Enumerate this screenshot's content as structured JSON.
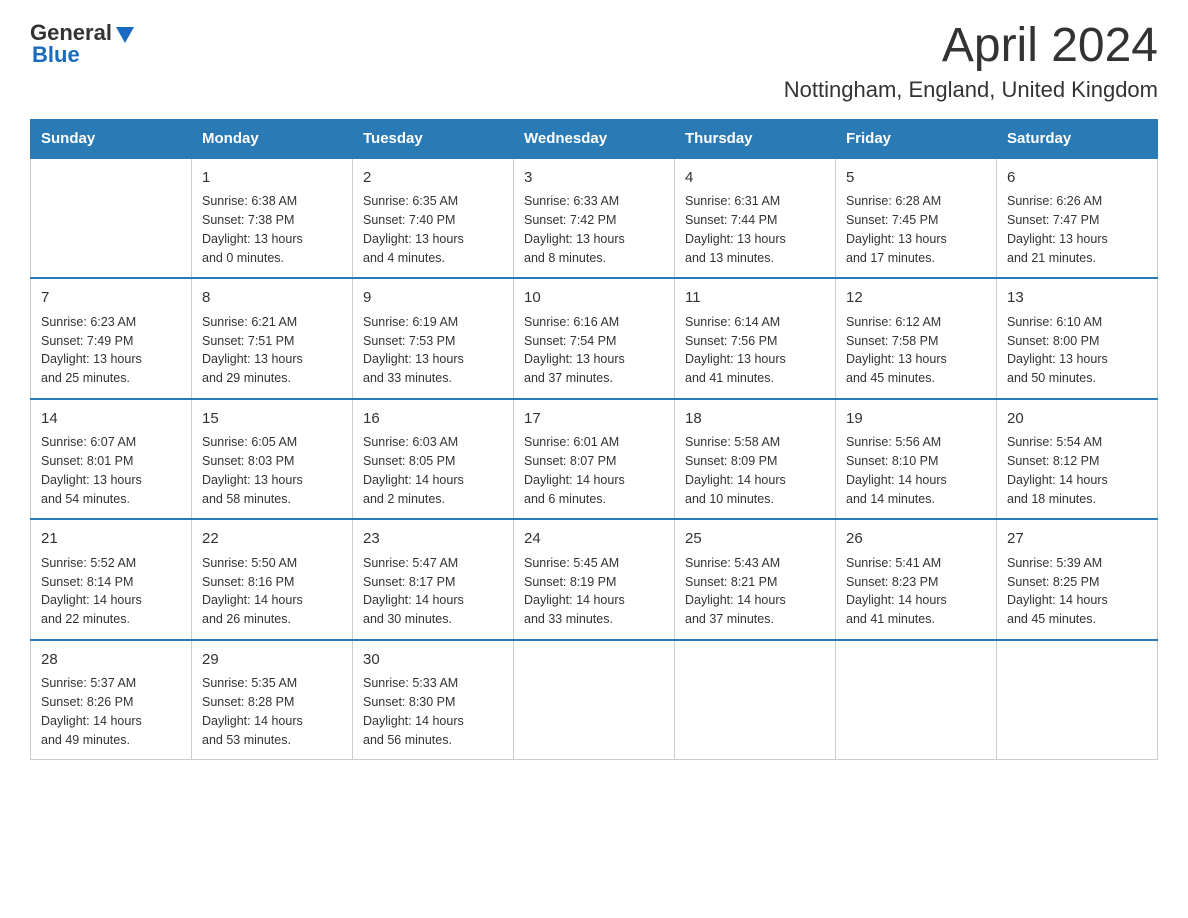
{
  "header": {
    "logo_general": "General",
    "logo_blue": "Blue",
    "title": "April 2024",
    "subtitle": "Nottingham, England, United Kingdom"
  },
  "days_of_week": [
    "Sunday",
    "Monday",
    "Tuesday",
    "Wednesday",
    "Thursday",
    "Friday",
    "Saturday"
  ],
  "weeks": [
    [
      {
        "day": "",
        "info": ""
      },
      {
        "day": "1",
        "info": "Sunrise: 6:38 AM\nSunset: 7:38 PM\nDaylight: 13 hours\nand 0 minutes."
      },
      {
        "day": "2",
        "info": "Sunrise: 6:35 AM\nSunset: 7:40 PM\nDaylight: 13 hours\nand 4 minutes."
      },
      {
        "day": "3",
        "info": "Sunrise: 6:33 AM\nSunset: 7:42 PM\nDaylight: 13 hours\nand 8 minutes."
      },
      {
        "day": "4",
        "info": "Sunrise: 6:31 AM\nSunset: 7:44 PM\nDaylight: 13 hours\nand 13 minutes."
      },
      {
        "day": "5",
        "info": "Sunrise: 6:28 AM\nSunset: 7:45 PM\nDaylight: 13 hours\nand 17 minutes."
      },
      {
        "day": "6",
        "info": "Sunrise: 6:26 AM\nSunset: 7:47 PM\nDaylight: 13 hours\nand 21 minutes."
      }
    ],
    [
      {
        "day": "7",
        "info": "Sunrise: 6:23 AM\nSunset: 7:49 PM\nDaylight: 13 hours\nand 25 minutes."
      },
      {
        "day": "8",
        "info": "Sunrise: 6:21 AM\nSunset: 7:51 PM\nDaylight: 13 hours\nand 29 minutes."
      },
      {
        "day": "9",
        "info": "Sunrise: 6:19 AM\nSunset: 7:53 PM\nDaylight: 13 hours\nand 33 minutes."
      },
      {
        "day": "10",
        "info": "Sunrise: 6:16 AM\nSunset: 7:54 PM\nDaylight: 13 hours\nand 37 minutes."
      },
      {
        "day": "11",
        "info": "Sunrise: 6:14 AM\nSunset: 7:56 PM\nDaylight: 13 hours\nand 41 minutes."
      },
      {
        "day": "12",
        "info": "Sunrise: 6:12 AM\nSunset: 7:58 PM\nDaylight: 13 hours\nand 45 minutes."
      },
      {
        "day": "13",
        "info": "Sunrise: 6:10 AM\nSunset: 8:00 PM\nDaylight: 13 hours\nand 50 minutes."
      }
    ],
    [
      {
        "day": "14",
        "info": "Sunrise: 6:07 AM\nSunset: 8:01 PM\nDaylight: 13 hours\nand 54 minutes."
      },
      {
        "day": "15",
        "info": "Sunrise: 6:05 AM\nSunset: 8:03 PM\nDaylight: 13 hours\nand 58 minutes."
      },
      {
        "day": "16",
        "info": "Sunrise: 6:03 AM\nSunset: 8:05 PM\nDaylight: 14 hours\nand 2 minutes."
      },
      {
        "day": "17",
        "info": "Sunrise: 6:01 AM\nSunset: 8:07 PM\nDaylight: 14 hours\nand 6 minutes."
      },
      {
        "day": "18",
        "info": "Sunrise: 5:58 AM\nSunset: 8:09 PM\nDaylight: 14 hours\nand 10 minutes."
      },
      {
        "day": "19",
        "info": "Sunrise: 5:56 AM\nSunset: 8:10 PM\nDaylight: 14 hours\nand 14 minutes."
      },
      {
        "day": "20",
        "info": "Sunrise: 5:54 AM\nSunset: 8:12 PM\nDaylight: 14 hours\nand 18 minutes."
      }
    ],
    [
      {
        "day": "21",
        "info": "Sunrise: 5:52 AM\nSunset: 8:14 PM\nDaylight: 14 hours\nand 22 minutes."
      },
      {
        "day": "22",
        "info": "Sunrise: 5:50 AM\nSunset: 8:16 PM\nDaylight: 14 hours\nand 26 minutes."
      },
      {
        "day": "23",
        "info": "Sunrise: 5:47 AM\nSunset: 8:17 PM\nDaylight: 14 hours\nand 30 minutes."
      },
      {
        "day": "24",
        "info": "Sunrise: 5:45 AM\nSunset: 8:19 PM\nDaylight: 14 hours\nand 33 minutes."
      },
      {
        "day": "25",
        "info": "Sunrise: 5:43 AM\nSunset: 8:21 PM\nDaylight: 14 hours\nand 37 minutes."
      },
      {
        "day": "26",
        "info": "Sunrise: 5:41 AM\nSunset: 8:23 PM\nDaylight: 14 hours\nand 41 minutes."
      },
      {
        "day": "27",
        "info": "Sunrise: 5:39 AM\nSunset: 8:25 PM\nDaylight: 14 hours\nand 45 minutes."
      }
    ],
    [
      {
        "day": "28",
        "info": "Sunrise: 5:37 AM\nSunset: 8:26 PM\nDaylight: 14 hours\nand 49 minutes."
      },
      {
        "day": "29",
        "info": "Sunrise: 5:35 AM\nSunset: 8:28 PM\nDaylight: 14 hours\nand 53 minutes."
      },
      {
        "day": "30",
        "info": "Sunrise: 5:33 AM\nSunset: 8:30 PM\nDaylight: 14 hours\nand 56 minutes."
      },
      {
        "day": "",
        "info": ""
      },
      {
        "day": "",
        "info": ""
      },
      {
        "day": "",
        "info": ""
      },
      {
        "day": "",
        "info": ""
      }
    ]
  ]
}
